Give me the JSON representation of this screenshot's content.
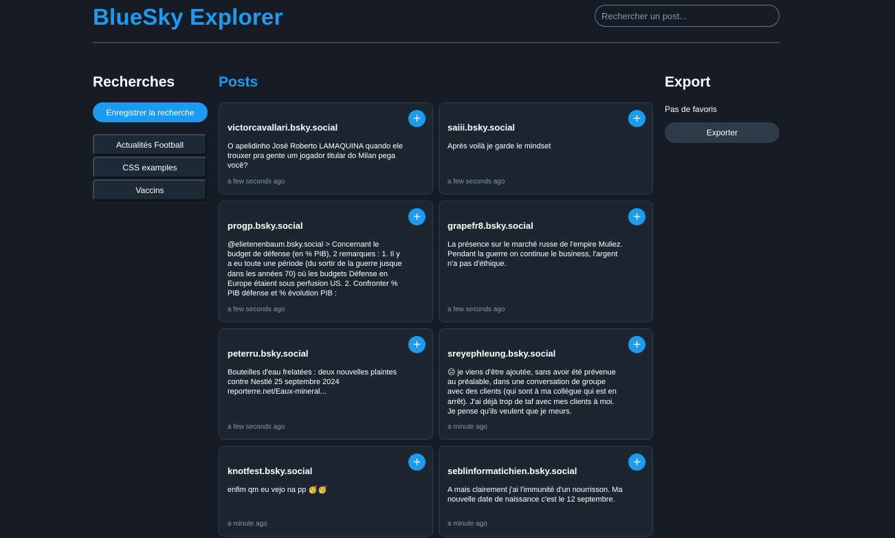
{
  "header": {
    "title": "BlueSky Explorer",
    "search_placeholder": "Rechercher un post..."
  },
  "searches": {
    "heading": "Recherches",
    "save_button": "Enregistrer la recherche",
    "items": [
      {
        "label": "Actualités Football"
      },
      {
        "label": "CSS examples"
      },
      {
        "label": "Vaccins"
      }
    ]
  },
  "posts": {
    "heading": "Posts",
    "add_icon": "+",
    "items": [
      {
        "author": "victorcavallari.bsky.social",
        "text": "O apelidinho José Roberto LAMAQUINA quando ele trouxer pra gente um jogador titular do Milan pega você?",
        "time": "a few seconds ago"
      },
      {
        "author": "saiii.bsky.social",
        "text": "Après voilà je garde le mindset",
        "time": "a few seconds ago"
      },
      {
        "author": "progp.bsky.social",
        "text": "@elietenenbaum.bsky.social > Concernant le budget de défense (en % PIB), 2 remarques : 1. Il y a eu toute une période (du sortir de la guerre jusque dans les années 70) où les budgets Défense en Europe étaient sous perfusion US. 2. Confronter % PIB défense et % évolution PIB :",
        "time": "a few seconds ago"
      },
      {
        "author": "grapefr8.bsky.social",
        "text": "La présence sur le marché russe de l'empire Muliez. Pendant la guerre on continue le business, l'argent n'a pas d'éthique.",
        "time": "a few seconds ago"
      },
      {
        "author": "peterru.bsky.social",
        "text": "Bouteilles d'eau frelatées : deux nouvelles plaintes contre Nestlé 25 septembre 2024 reporterre.net/Eaux-mineral...",
        "time": "a few seconds ago"
      },
      {
        "author": "sreyephleung.bsky.social",
        "text": "😑 je viens d'être ajoutée, sans avoir été prévenue au préalable, dans une conversation de groupe avec des clients (qui sont à ma collègue qui est en arrêt). J'ai déjà trop de taf avec mes clients à moi. Je pense qu'ils veulent que je meurs.",
        "time": "a minute ago"
      },
      {
        "author": "knotfest.bsky.social",
        "text": "enfim qm eu vejo na pp 🥳🥳",
        "time": "a minute ago"
      },
      {
        "author": "seblinformatichien.bsky.social",
        "text": "A mais clairement j'ai l'immunité d'un nourrisson. Ma nouvelle date de naissance c'est le 12 septembre.",
        "time": "a minute ago"
      }
    ]
  },
  "export": {
    "heading": "Export",
    "empty_text": "Pas de favoris",
    "button": "Exporter"
  }
}
